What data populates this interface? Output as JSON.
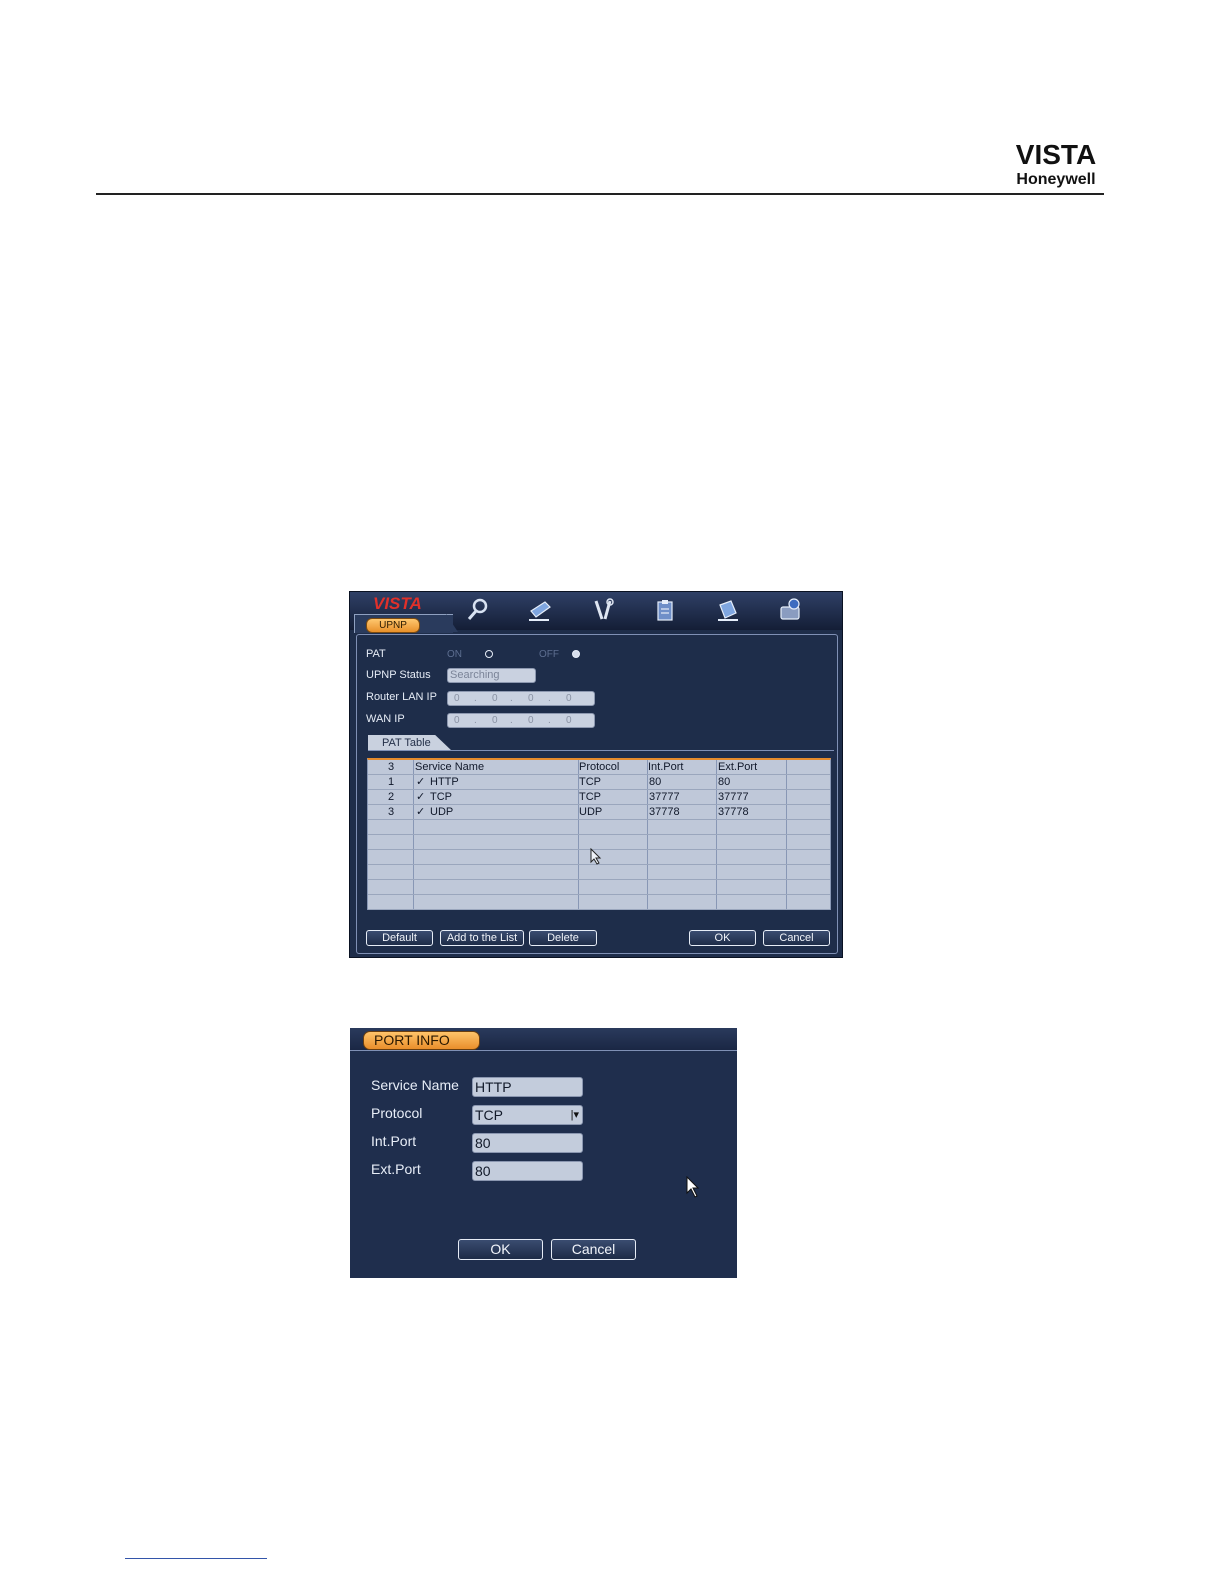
{
  "header": {
    "logo_line1": "VISTA",
    "logo_line2": "Honeywell"
  },
  "upnp": {
    "brand": "VISTA",
    "tab_label": "UPNP",
    "toolbar_icons": [
      "search-icon",
      "note-icon",
      "tools-icon",
      "clipboard-icon",
      "network-icon",
      "disk-icon"
    ],
    "pat_label": "PAT",
    "on_label": "ON",
    "off_label": "OFF",
    "selected": "OFF",
    "status_label": "UPNP Status",
    "status_value": "Searching",
    "router_ip_label": "Router LAN IP",
    "router_ip": [
      "0",
      "0",
      "0",
      "0"
    ],
    "wan_ip_label": "WAN IP",
    "wan_ip": [
      "0",
      "0",
      "0",
      "0"
    ],
    "pat_table_label": "PAT Table",
    "table": {
      "headers": [
        "3",
        "Service Name",
        "Protocol",
        "Int.Port",
        "Ext.Port"
      ],
      "rows": [
        {
          "no": "1",
          "check": "✓",
          "name": "HTTP",
          "protocol": "TCP",
          "int": "80",
          "ext": "80"
        },
        {
          "no": "2",
          "check": "✓",
          "name": "TCP",
          "protocol": "TCP",
          "int": "37777",
          "ext": "37777"
        },
        {
          "no": "3",
          "check": "✓",
          "name": "UDP",
          "protocol": "UDP",
          "int": "37778",
          "ext": "37778"
        }
      ]
    },
    "buttons": {
      "default": "Default",
      "add": "Add to the List",
      "delete": "Delete",
      "ok": "OK",
      "cancel": "Cancel"
    }
  },
  "port_info": {
    "title": "PORT INFO",
    "service_name_label": "Service Name",
    "service_name": "HTTP",
    "protocol_label": "Protocol",
    "protocol": "TCP",
    "int_port_label": "Int.Port",
    "int_port": "80",
    "ext_port_label": "Ext.Port",
    "ext_port": "80",
    "ok": "OK",
    "cancel": "Cancel"
  },
  "colors": {
    "accent_orange": "#e98e2b",
    "panel_navy": "#1e2d4a",
    "brand_red": "#e0302a"
  }
}
